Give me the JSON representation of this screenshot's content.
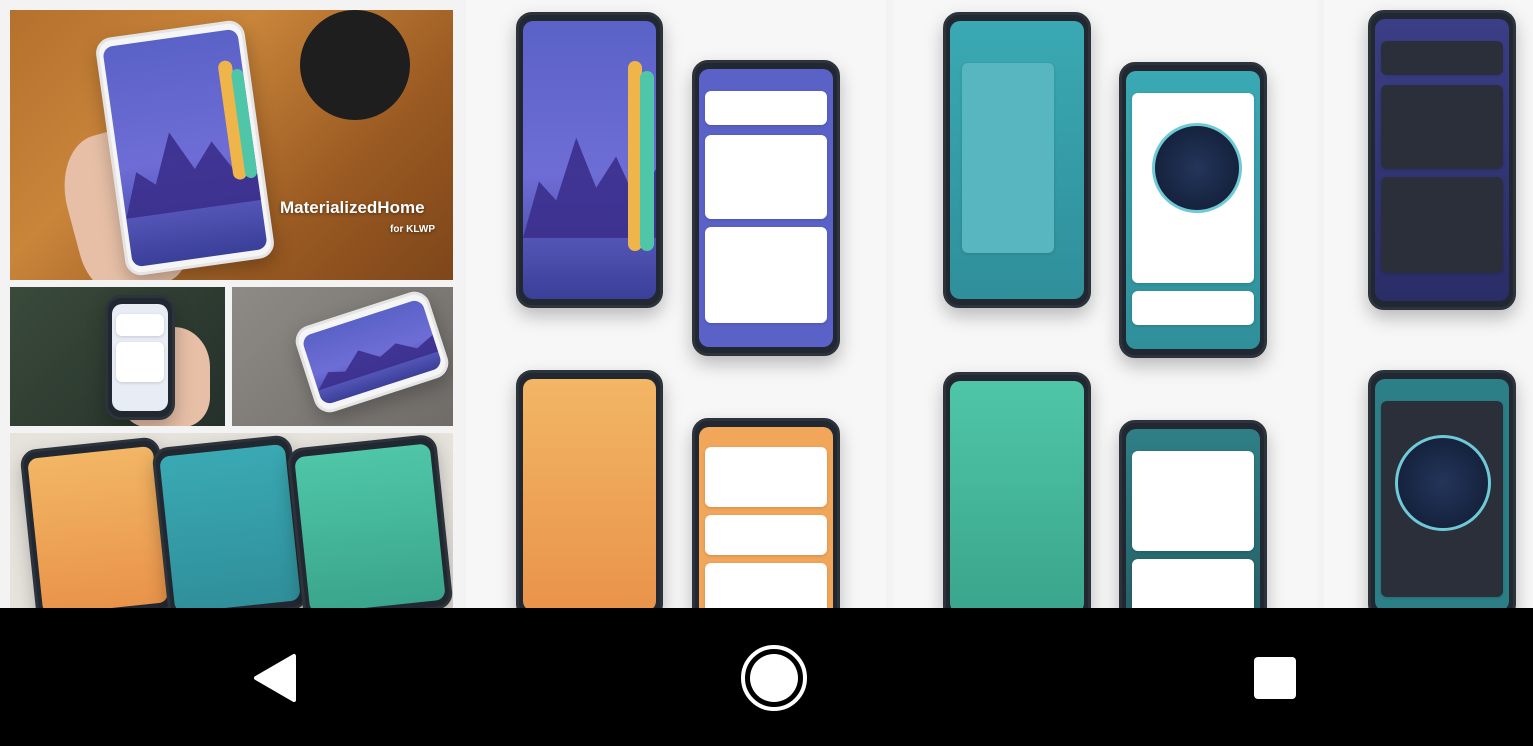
{
  "gallery": {
    "hero": {
      "title": "MaterializedHome",
      "subtitle": "for KLWP"
    }
  },
  "colors": {
    "nav_background": "#000000",
    "nav_icon": "#ffffff",
    "purple_theme": "#5a62c7",
    "teal_theme": "#3aa9b3",
    "orange_theme": "#f2b665",
    "green_theme": "#4fc6a7"
  },
  "navbar": {
    "back_icon": "back-triangle-icon",
    "home_icon": "home-circle-icon",
    "recents_icon": "recents-square-icon"
  }
}
